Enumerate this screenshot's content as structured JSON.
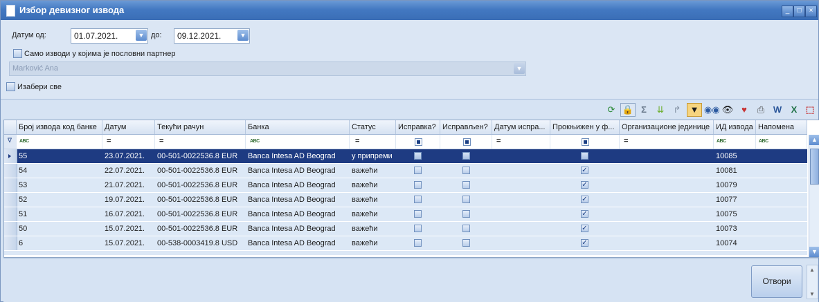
{
  "window": {
    "title": "Избор девизног извода",
    "min_label": "_",
    "max_label": "□",
    "close_label": "×"
  },
  "filters": {
    "date_from_label": "Датум од:",
    "date_from_value": "01.07.2021.",
    "date_to_label": "до:",
    "date_to_value": "09.12.2021.",
    "partner_only_label": "Само изводи у којима је пословни партнер",
    "partner_value": "Marković Ana",
    "select_all_label": "Изабери све"
  },
  "toolbar": {
    "icons": [
      "refresh-icon",
      "lock-icon",
      "sum-icon",
      "expand-down-icon",
      "forward-icon",
      "filter-icon",
      "binoculars-icon",
      "eye-icon",
      "heart-icon",
      "print-icon",
      "word-export-icon",
      "excel-export-icon",
      "pdf-export-icon"
    ]
  },
  "grid": {
    "columns": [
      "Број извода код банке",
      "Датум",
      "Текући рачун",
      "Банка",
      "Статус",
      "Исправка?",
      "Исправљен?",
      "Датум испра...",
      "Прокњижен у ф...",
      "Организационе јединице",
      "ИД извода",
      "Напомена"
    ],
    "filter_abc": "ABC",
    "filter_eq": "=",
    "rows": [
      {
        "broj": "55",
        "datum": "23.07.2021.",
        "racun": "00-501-0022536.8 EUR",
        "banka": "Banca Intesa AD Beograd",
        "status": "у припреми",
        "ispravka": false,
        "ispravljen": false,
        "proknjizen": false,
        "id": "10085",
        "selected": true
      },
      {
        "broj": "54",
        "datum": "22.07.2021.",
        "racun": "00-501-0022536.8 EUR",
        "banka": "Banca Intesa AD Beograd",
        "status": "важећи",
        "ispravka": false,
        "ispravljen": false,
        "proknjizen": true,
        "id": "10081",
        "selected": false
      },
      {
        "broj": "53",
        "datum": "21.07.2021.",
        "racun": "00-501-0022536.8 EUR",
        "banka": "Banca Intesa AD Beograd",
        "status": "важећи",
        "ispravka": false,
        "ispravljen": false,
        "proknjizen": true,
        "id": "10079",
        "selected": false
      },
      {
        "broj": "52",
        "datum": "19.07.2021.",
        "racun": "00-501-0022536.8 EUR",
        "banka": "Banca Intesa AD Beograd",
        "status": "важећи",
        "ispravka": false,
        "ispravljen": false,
        "proknjizen": true,
        "id": "10077",
        "selected": false
      },
      {
        "broj": "51",
        "datum": "16.07.2021.",
        "racun": "00-501-0022536.8 EUR",
        "banka": "Banca Intesa AD Beograd",
        "status": "важећи",
        "ispravka": false,
        "ispravljen": false,
        "proknjizen": true,
        "id": "10075",
        "selected": false
      },
      {
        "broj": "50",
        "datum": "15.07.2021.",
        "racun": "00-501-0022536.8 EUR",
        "banka": "Banca Intesa AD Beograd",
        "status": "важећи",
        "ispravka": false,
        "ispravljen": false,
        "proknjizen": true,
        "id": "10073",
        "selected": false
      },
      {
        "broj": "6",
        "datum": "15.07.2021.",
        "racun": "00-538-0003419.8 USD",
        "banka": "Banca Intesa AD Beograd",
        "status": "важећи",
        "ispravka": false,
        "ispravljen": false,
        "proknjizen": true,
        "id": "10074",
        "selected": false
      }
    ]
  },
  "buttons": {
    "open_label": "Отвори"
  }
}
